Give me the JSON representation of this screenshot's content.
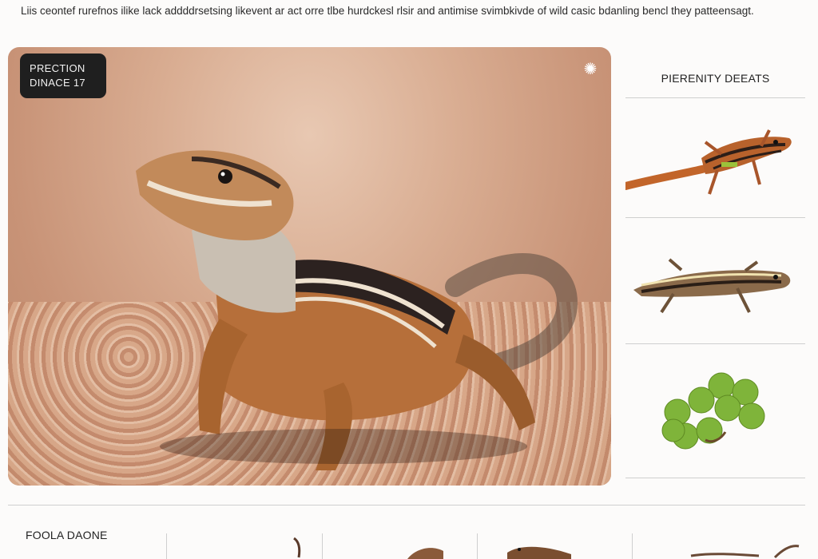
{
  "intro_text": "Liis ceontef rurefnos ilike lack addddrsetsing likevent ar act orre tlbe hurdckesl rlsir and antimise svimbkivde of wild casic bdanling bencl they patteensagt.",
  "hero": {
    "badge_line1": "PRECTION",
    "badge_line2": "DINACE 17",
    "expand_icon": "sparkle-expand-icon"
  },
  "sidebar": {
    "title": "PIERENITY DEEATS",
    "items": [
      {
        "icon": "striped-lizard-thumbnail"
      },
      {
        "icon": "gecko-thumbnail"
      },
      {
        "icon": "green-grapes-thumbnail"
      }
    ]
  },
  "food_section": {
    "title": "FOOLA DAONE"
  },
  "colors": {
    "background": "#fcfbfa",
    "badge": "#1f1f1f",
    "divider": "#cfcfcf"
  }
}
